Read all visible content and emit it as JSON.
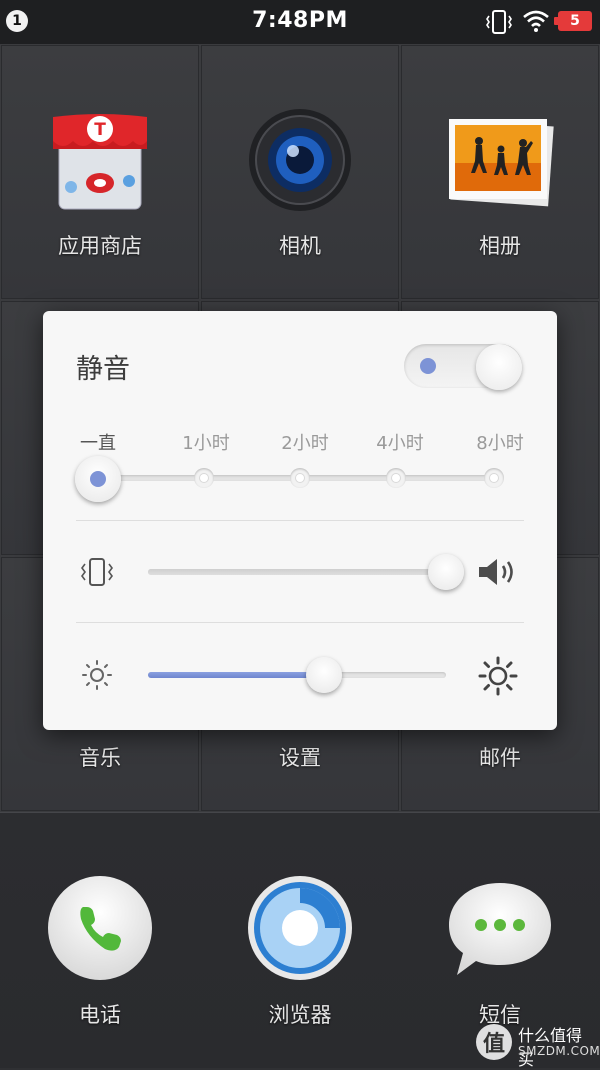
{
  "status_bar": {
    "notification_count": "1",
    "time": "7:48PM",
    "battery_level": "5",
    "icons": [
      "vibrate-icon",
      "wifi-icon",
      "battery-icon"
    ]
  },
  "apps": [
    {
      "label": "应用商店",
      "icon": "app-store-icon"
    },
    {
      "label": "相机",
      "icon": "camera-icon"
    },
    {
      "label": "相册",
      "icon": "gallery-icon"
    },
    {
      "label": "音乐",
      "icon": "music-icon"
    },
    {
      "label": "设置",
      "icon": "settings-icon"
    },
    {
      "label": "邮件",
      "icon": "mail-icon"
    }
  ],
  "dock": [
    {
      "label": "电话",
      "icon": "phone-icon"
    },
    {
      "label": "浏览器",
      "icon": "browser-icon"
    },
    {
      "label": "短信",
      "icon": "messages-icon"
    }
  ],
  "panel": {
    "mute_label": "静音",
    "mute_enabled": true,
    "duration_options": [
      "一直",
      "1小时",
      "2小时",
      "4小时",
      "8小时"
    ],
    "duration_selected": "一直",
    "volume_level": 1.0,
    "brightness_level": 0.59,
    "accent_color": "#7d93d6"
  },
  "watermark": {
    "text": "什么值得买",
    "sub": "SMZDM.COM",
    "logo_char": "值"
  }
}
